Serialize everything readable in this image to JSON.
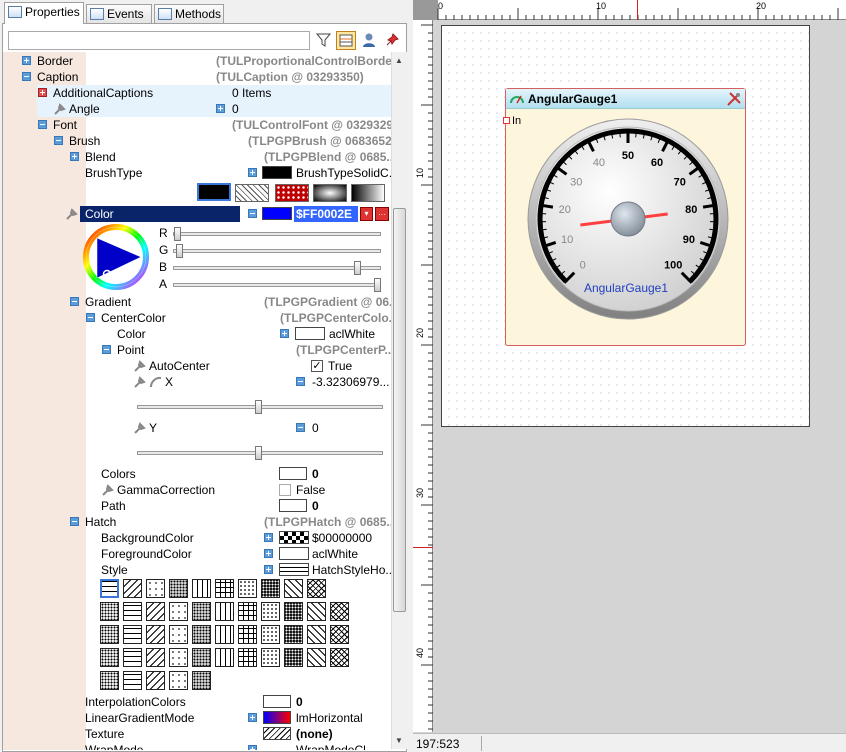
{
  "tabs": [
    {
      "label": "Properties"
    },
    {
      "label": "Events"
    },
    {
      "label": "Methods"
    }
  ],
  "search": {
    "value": ""
  },
  "tree": {
    "border": {
      "name": "Border",
      "value": "(TULProportionalControlBorder..."
    },
    "caption": {
      "name": "Caption",
      "value": "(TULCaption @ 03293350)"
    },
    "additional_captions": {
      "name": "AdditionalCaptions",
      "value": "0 Items"
    },
    "angle": {
      "name": "Angle",
      "value": "0"
    },
    "font": {
      "name": "Font",
      "value": "(TULControlFont @ 0329329..."
    },
    "brush": {
      "name": "Brush",
      "value": "(TLPGPBrush @ 0683652..."
    },
    "blend": {
      "name": "Blend",
      "value": "(TLPGPBlend @ 0685..."
    },
    "brush_type": {
      "name": "BrushType",
      "value": "BrushTypeSolidC..."
    },
    "color": {
      "name": "Color",
      "value": "$FF0002E"
    },
    "rgba": {
      "r": "R",
      "g": "G",
      "b": "B",
      "a": "A",
      "r_val": 0.0,
      "g_val": 0.01,
      "b_val": 0.9,
      "a_val": 1.0
    },
    "gradient": {
      "name": "Gradient",
      "value": "(TLPGPGradient @ 06..."
    },
    "center_color": {
      "name": "CenterColor",
      "value": "(TLPGPCenterColo..."
    },
    "color2": {
      "name": "Color",
      "value": "aclWhite"
    },
    "point": {
      "name": "Point",
      "value": "(TLPGPCenterP..."
    },
    "auto_center": {
      "name": "AutoCenter",
      "value": "True"
    },
    "x": {
      "name": "X",
      "value": "-3.32306979...",
      "slider": 0.49
    },
    "y": {
      "name": "Y",
      "value": "0",
      "slider": 0.49
    },
    "colors": {
      "name": "Colors",
      "value": "0"
    },
    "gamma": {
      "name": "GammaCorrection",
      "value": "False"
    },
    "path": {
      "name": "Path",
      "value": "0"
    },
    "hatch": {
      "name": "Hatch",
      "value": "(TLPGPHatch @ 0685..."
    },
    "bg_color": {
      "name": "BackgroundColor",
      "value": "$00000000"
    },
    "fg_color": {
      "name": "ForegroundColor",
      "value": "aclWhite"
    },
    "style": {
      "name": "Style",
      "value": "HatchStyleHo..."
    },
    "interp": {
      "name": "InterpolationColors",
      "value": "0"
    },
    "lgm": {
      "name": "LinearGradientMode",
      "value": "lmHorizontal"
    },
    "texture": {
      "name": "Texture",
      "value": "(none)"
    },
    "wrap": {
      "name": "WrapMode",
      "value": "WrapModeCl..."
    }
  },
  "ruler": {
    "h": [
      "0",
      "10",
      "20"
    ],
    "v": [
      "10",
      "20",
      "30",
      "40"
    ]
  },
  "component": {
    "title": "AngularGauge1",
    "pin": "In",
    "caption": "AngularGauge1",
    "ticks": [
      "0",
      "10",
      "20",
      "30",
      "40",
      "50",
      "60",
      "70",
      "80",
      "90",
      "100"
    ],
    "value": 14
  },
  "status": {
    "coords": "197:523"
  },
  "colors": {
    "selection": "#0a246a",
    "accent": "#0000ff",
    "needle": "#ff4040",
    "caption": "#1f3fc0"
  }
}
